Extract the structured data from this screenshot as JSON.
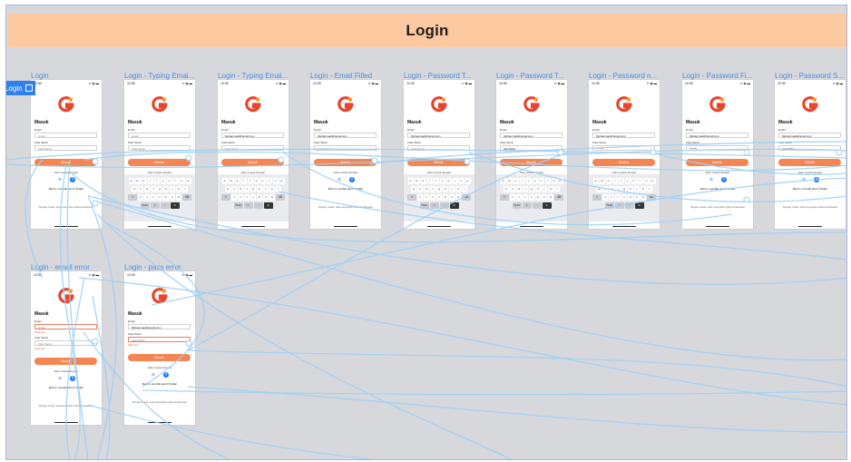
{
  "section": {
    "title": "Login",
    "tag": "Login"
  },
  "colors": {
    "accent": "#f58552",
    "wire": "#9fd0f4",
    "header": "#fdc9a0",
    "label": "#4a90e2"
  },
  "frames": [
    {
      "label": "Login",
      "email": "",
      "password": "",
      "keyboard": false,
      "error": ""
    },
    {
      "label": "Login - Typing Emai...",
      "email": "",
      "password": "",
      "keyboard": true,
      "error": ""
    },
    {
      "label": "Login - Typing Emai...",
      "email": "Muhammad@gmail.com",
      "password": "",
      "keyboard": true,
      "error": ""
    },
    {
      "label": "Login - Email Filled",
      "email": "Muhammad@gmail.com",
      "password": "",
      "keyboard": false,
      "error": ""
    },
    {
      "label": "Login - Password T...",
      "email": "Muhammad@gmail.com",
      "password": "",
      "keyboard": true,
      "error": ""
    },
    {
      "label": "Login - Password T...",
      "email": "Muhammad@gmail.com",
      "password": "Abm9224",
      "keyboard": true,
      "error": ""
    },
    {
      "label": "Login - Password n...",
      "email": "Muhammad@gmail.com",
      "password": "*******",
      "keyboard": true,
      "error": ""
    },
    {
      "label": "Login - Password Fi...",
      "email": "Muhammad@gmail.com",
      "password": "*******",
      "keyboard": false,
      "error": ""
    },
    {
      "label": "Login - Password S...",
      "email": "Muhammad@gmail.com",
      "password": "Abm9224",
      "keyboard": false,
      "error": ""
    },
    {
      "label": "Login - email error",
      "email": "",
      "password": "",
      "keyboard": false,
      "error": "email"
    },
    {
      "label": "Login - pass error",
      "email": "Muhammad@gmail.com",
      "password": "",
      "keyboard": false,
      "error": "pass"
    }
  ],
  "screen": {
    "status_time": "12:30",
    "status_icons": "▪▪ ◉ ▬",
    "title": "Masuk",
    "email_label": "Email",
    "email_placeholder": "Email",
    "password_label": "Kata Sandi",
    "password_placeholder": "Kata Sandi",
    "error_text": "Wajib diisi",
    "submit": "Masuk",
    "alt_login": "Atau masuk dengan",
    "register": "Belum memiliki akun? Daftar",
    "terms": "Dengan masuk, saya menyetujui syarat & ketentuan",
    "keyboard_rows": [
      [
        "q",
        "w",
        "e",
        "r",
        "t",
        "y",
        "u",
        "i",
        "o",
        "p"
      ],
      [
        "a",
        "s",
        "d",
        "f",
        "g",
        "h",
        "j",
        "k",
        "l"
      ],
      [
        "⇧",
        "z",
        "x",
        "c",
        "v",
        "b",
        "n",
        "m",
        "⌫"
      ]
    ],
    "keyboard_bottom": [
      "?123",
      "☺",
      "◌",
      "➜"
    ]
  }
}
